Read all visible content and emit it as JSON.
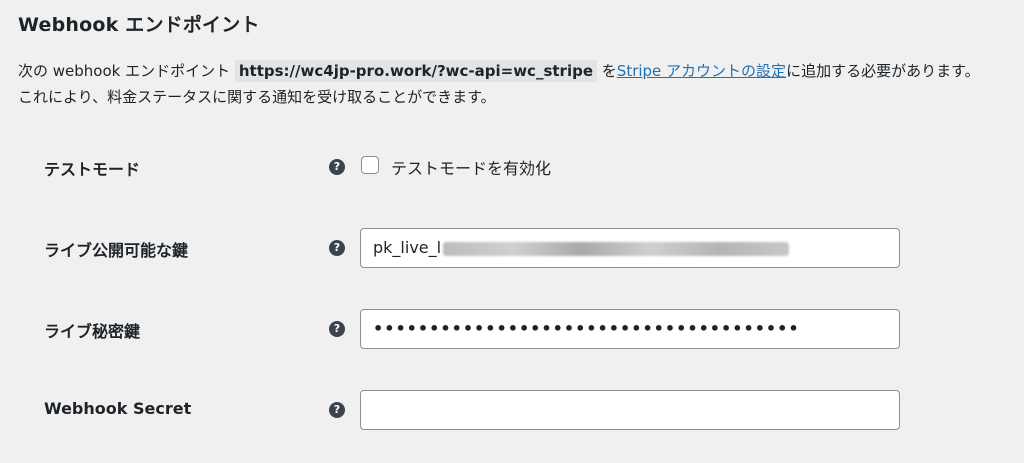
{
  "section": {
    "title": "Webhook エンドポイント",
    "description_before": "次の webhook エンドポイント ",
    "endpoint_url": "https://wc4jp-pro.work/?wc-api=wc_stripe",
    "description_mid": " を",
    "link_text": "Stripe アカウントの設定",
    "description_after_line1": "に追加する必要があります。",
    "description_line2": "これにより、料金ステータスに関する通知を受け取ることができます。"
  },
  "fields": {
    "test_mode": {
      "label": "テストモード",
      "checkbox_label": "テストモードを有効化",
      "checked": false,
      "help_icon": "question-circle-icon"
    },
    "live_publishable_key": {
      "label": "ライブ公開可能な鍵",
      "value_visible": "pk_live_l",
      "value_redacted": true,
      "help_icon": "question-circle-icon"
    },
    "live_secret_key": {
      "label": "ライブ秘密鍵",
      "value_masked": "••••••••••••••••••••••••••••••••••••••",
      "help_icon": "question-circle-icon"
    },
    "webhook_secret": {
      "label": "Webhook Secret",
      "value": "",
      "help_icon": "question-circle-icon"
    }
  },
  "colors": {
    "background": "#f0f0f1",
    "text": "#1d2327",
    "link": "#2271b1",
    "input_border": "#8c8f94",
    "code_background": "#e2e3e4"
  }
}
